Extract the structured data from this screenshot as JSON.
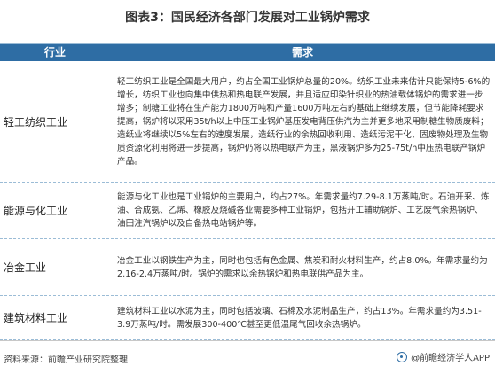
{
  "title": "图表3：国民经济各部门发展对工业锅炉需求",
  "table": {
    "headers": [
      "行业",
      "需求"
    ],
    "rows": [
      {
        "industry": "轻工纺织工业",
        "demand": "轻工纺织工业是全国最大用户，约占全国工业锅炉总量的20%。纺织工业未来估计只能保持5-6%的增长，纺织工业也向集中供热和热电联产发展，并且适应印染针织业的热油载体锅炉的需求进一步增多；制糖工业将在生产能力1800万吨和产量1600万吨左右的基础上继续发展，但节能降耗要求提高，锅炉将以采用35t/h以上中压工业锅炉基压发电背压供汽为主并更多地采用制糖生物质废料；造纸业将继续以5%左右的速度发展，造纸行业的余热回收利用、造纸污泥干化、固废物处理及生物质资源化利用将进一步提高，锅炉仍将以热电联产为主，黑液锅炉多为25-75t/h中压热电联产锅炉产品。"
      },
      {
        "industry": "能源与化工业",
        "demand": "能源与化工业也是工业锅炉的主要用户，约占27%。年需求量约7.29-8.1万蒸吨/时。石油开采、炼油、合成氨、乙烯、橡胶及烧碱各业需要多种工业锅炉，包括开工辅助锅炉、工艺废气余热锅炉、油田注汽锅炉以及自备热电站锅炉等。"
      },
      {
        "industry": "冶金工业",
        "demand": "冶金工业以钢铁生产为主，同时也包括有色金属、焦炭和耐火材料生产，约占8.0%。年需求量约为2.16-2.4万蒸吨/时。锅炉的需求以余热锅炉和热电联供产品为主。"
      },
      {
        "industry": "建筑材料工业",
        "demand": "建筑材料工业以水泥为主，同时包括玻璃、石棉及水泥制品生产，约占13%。年需求量约为3.51-3.9万蒸吨/时。需发展300-400℃甚至更低温尾气回收余热锅炉。"
      }
    ]
  },
  "footer": {
    "source": "资料来源：前瞻产业研究院整理",
    "brand": "@前瞻经济学人APP"
  }
}
